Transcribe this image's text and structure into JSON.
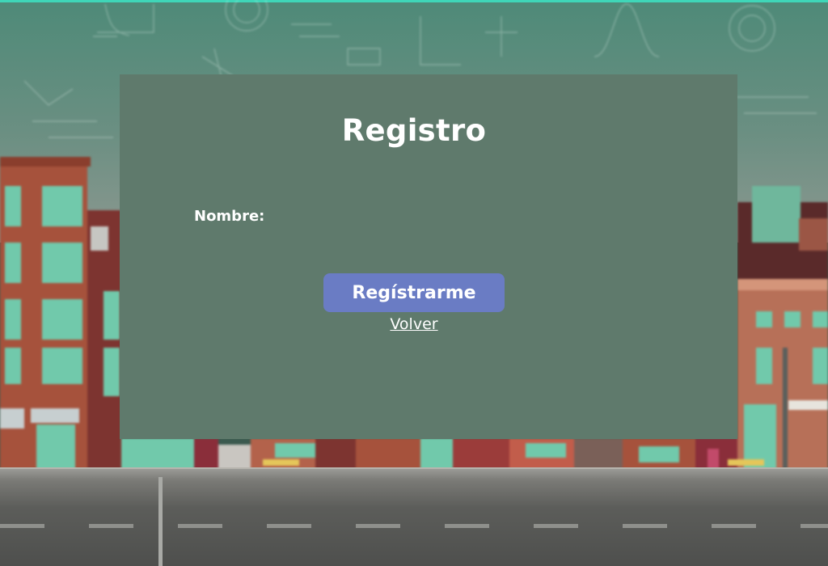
{
  "page": {
    "title": "Registro"
  },
  "form": {
    "name_label": "Nombre:",
    "submit_label": "Regístrarme",
    "back_label": "Volver"
  },
  "colors": {
    "card": "#5f7a6c",
    "button": "#6a7cc4",
    "text": "#ffffff"
  }
}
